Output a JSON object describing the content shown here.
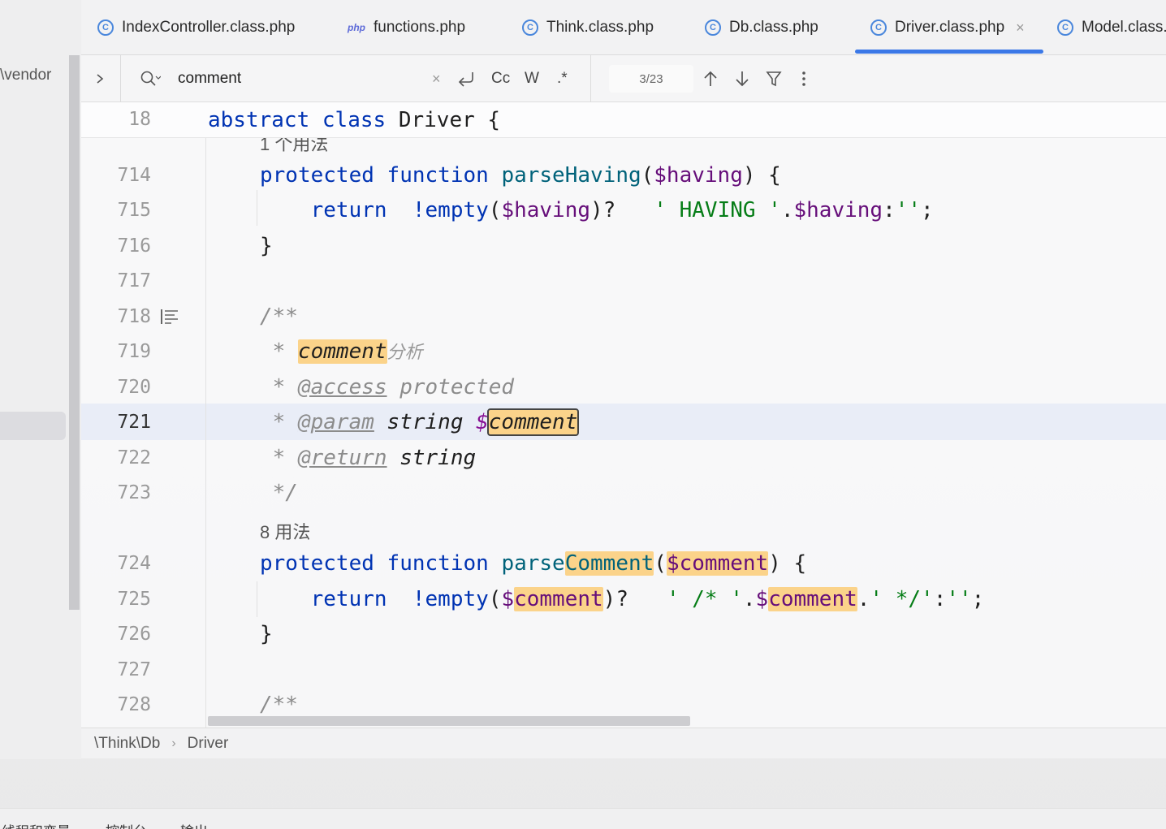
{
  "sidebar": {
    "path_fragment": "\\vendor"
  },
  "tabs": [
    {
      "label": "IndexController.class.php",
      "icon": "class-icon"
    },
    {
      "label": "functions.php",
      "icon": "php-file-icon"
    },
    {
      "label": "Think.class.php",
      "icon": "class-icon"
    },
    {
      "label": "Db.class.php",
      "icon": "class-icon"
    },
    {
      "label": "Driver.class.php",
      "icon": "class-icon",
      "active": true
    },
    {
      "label": "Model.class.",
      "icon": "class-icon"
    }
  ],
  "find": {
    "query": "comment",
    "match_count": "3/23",
    "case_label": "Cc",
    "words_label": "W",
    "regex_label": ".*"
  },
  "editor": {
    "sticky": {
      "line": "18",
      "kw1": "abstract",
      "kw2": "class",
      "name": "Driver",
      "brace": "{"
    },
    "cut_hint": "1 个用法",
    "usage_hint": "8 用法",
    "lines": {
      "l714": "714",
      "l715": "715",
      "l716": "716",
      "l717": "717",
      "l718": "718",
      "l719": "719",
      "l720": "720",
      "l721": "721",
      "l722": "722",
      "l723": "723",
      "l724": "724",
      "l725": "725",
      "l726": "726",
      "l727": "727",
      "l728": "728"
    },
    "code": {
      "protected": "protected",
      "function": "function",
      "return": "return",
      "parseHaving": "parseHaving",
      "having_var": "$having",
      "empty": "!empty",
      "having_str": "' HAVING '",
      "empty_str": "''",
      "doc_open": "/**",
      "star": "*",
      "doc_word": "comment",
      "doc_cjk": "分析",
      "access_tag": "@access",
      "access_val": "protected",
      "param_tag": "@param",
      "param_type": "string",
      "dollar": "$",
      "param_name": "comment",
      "return_tag": "@return",
      "return_type": "string",
      "doc_close": "*/",
      "parse": "parse",
      "Comment": "Comment",
      "comment_var": "comment",
      "cm_open_str": "' /* '",
      "cm_close_str": "' */'",
      "colon": ":"
    }
  },
  "breadcrumb": {
    "namespace": "\\Think\\Db",
    "class": "Driver"
  },
  "bottom_tabs": [
    "线程和变量",
    "控制台",
    "输出"
  ]
}
